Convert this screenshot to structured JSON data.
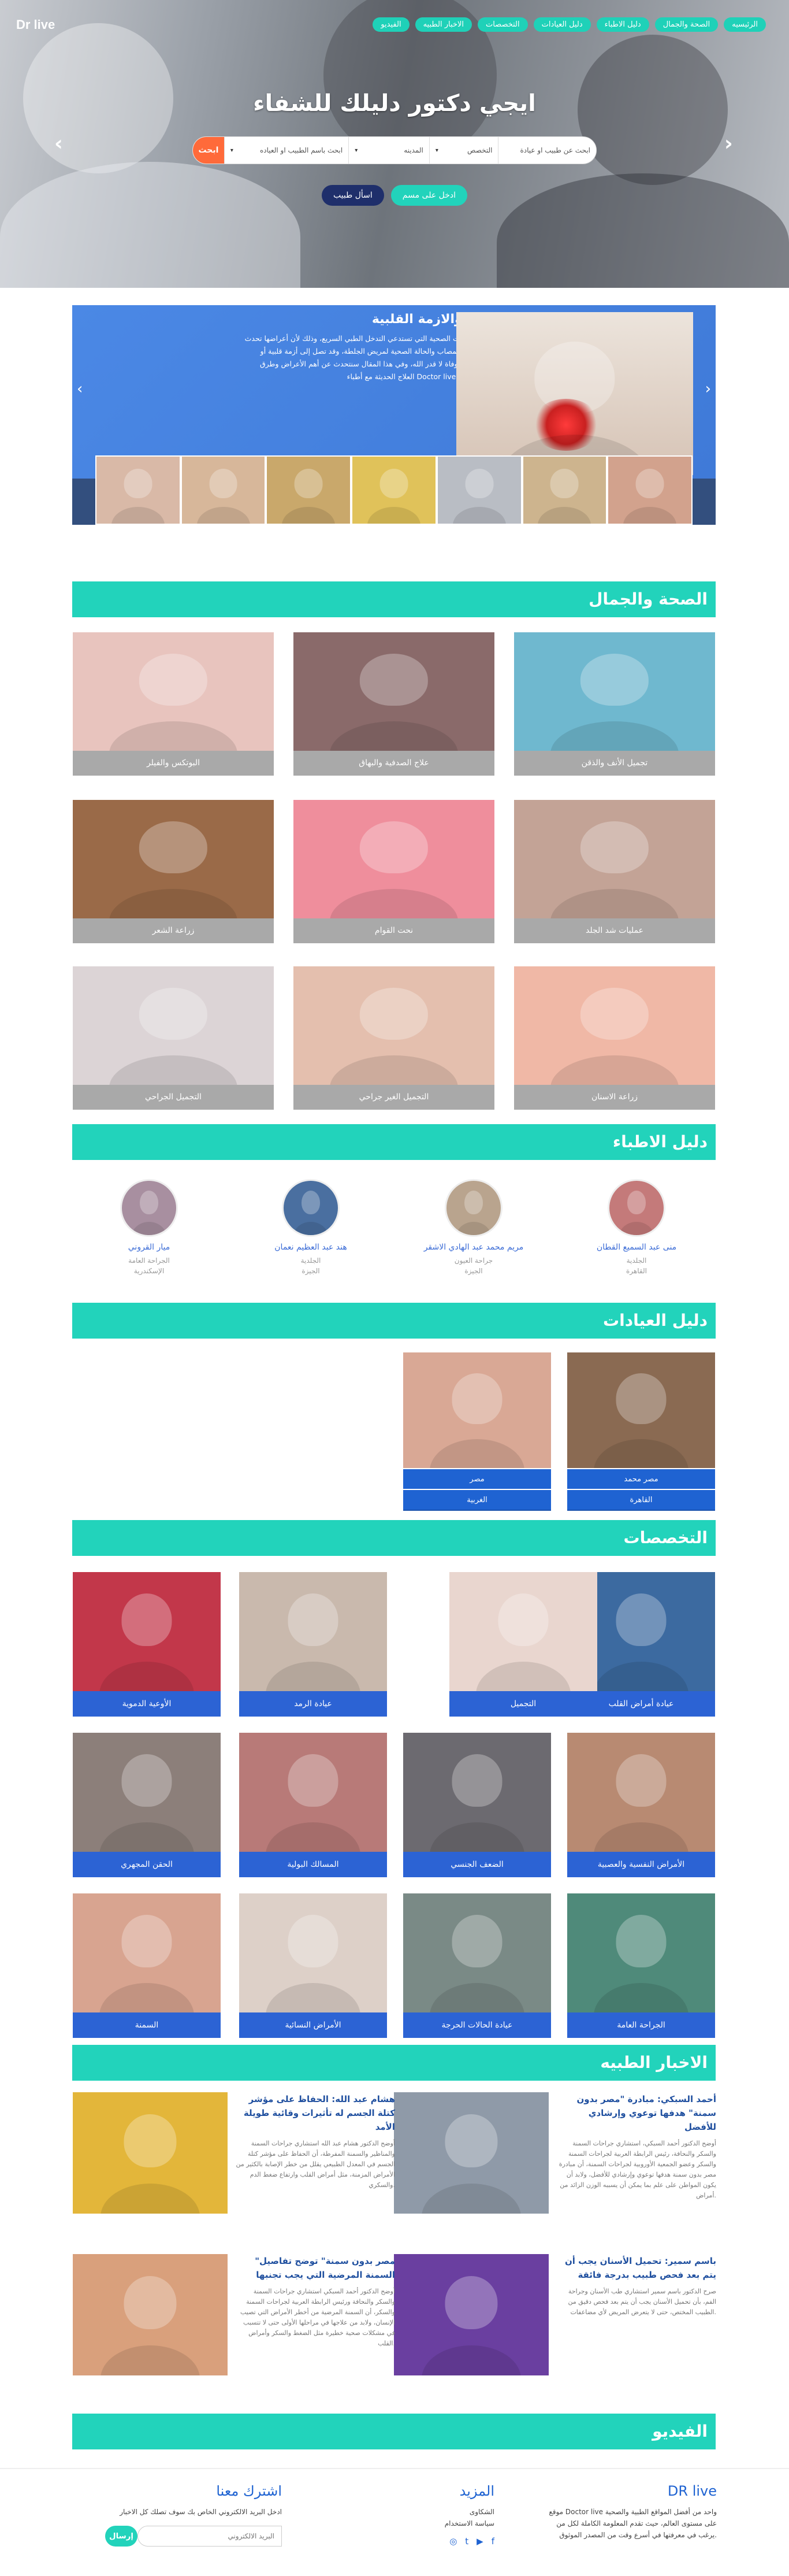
{
  "header": {
    "logo": "Dr live",
    "nav": [
      "الرئيسيه",
      "الصحة والجمال",
      "دليل الاطباء",
      "دليل العيادات",
      "التخصصات",
      "الاخبار الطبيه",
      "الفيديو"
    ]
  },
  "hero": {
    "title": "ايجي دكتور دليلك للشفاء",
    "search_placeholder": "ابحث عن طبيب او عيادة",
    "field_specialty": "التخصص",
    "field_city": "المدينه",
    "field_name": "ابحث باسم الطبيب او العياده",
    "search_button": "ابحث",
    "btn_register": "ادخل على مسم",
    "btn_ask": "اسأل طبيب"
  },
  "slider": {
    "title": "علاج الجلطة والازمة القلبية",
    "body": "الجلطات المختلفة من الحالات الصحية التي تستدعي التدخل الطبي السريع، وذلك لأن أعراضها تحدث الكثير من المضاعفات على المصاب والحالة الصحية لمريض الجلطة، وقد تصل إلى أزمة قلبية أو جلطة دماغية قد تنجم عنها الوفاة لا قدر الله، وفي هذا المقال سنتحدث عن أهم الأعراض وطرق العلاج الحديثة مع أطباء Doctor live المتخصصين في هذا المجال."
  },
  "sections": {
    "beauty": "الصحة والجمال",
    "doctors": "دليل الاطباء",
    "clinics": "دليل العيادات",
    "specialties": "التخصصات",
    "news": "الاخبار الطبيه",
    "video": "الفيديو"
  },
  "beauty": [
    "تجميل الأنف والذقن",
    "علاج الصدفية والبهاق",
    "البوتكس والفيلر",
    "عمليات شد الجلد",
    "نحت القوام",
    "زراعة الشعر",
    "زراعة الاسنان",
    "التجميل الغير جراحي",
    "التجميل الجراحي"
  ],
  "doctors": [
    {
      "name": "منى عبد السميع القطان",
      "spec": "الجلدية",
      "city": "القاهرة"
    },
    {
      "name": "مريم محمد عبد الهادي الاشقر",
      "spec": "جراحة العيون",
      "city": "الجيزة"
    },
    {
      "name": "هند عبد العظيم نعمان",
      "spec": "الجلدية",
      "city": "الجيزة"
    },
    {
      "name": "ميار القروني",
      "spec": "الجراحة العامة",
      "city": "الإسكندرية"
    }
  ],
  "clinics": [
    {
      "name": "مصر محمد",
      "area": "القاهرة"
    },
    {
      "name": "مصر",
      "area": "الغربية"
    }
  ],
  "specialties": [
    "عيادة أمراض القلب",
    "التجميل",
    "عيادة الرمد",
    "الأوعية الدموية",
    "الأمراض النفسية والعصبية",
    "الضعف الجنسي",
    "المسالك البولية",
    "الحقن المجهري",
    "الجراحة العامة",
    "عيادة الحالات الحرجة",
    "الأمراض النسائية",
    "السمنة"
  ],
  "news": [
    {
      "title": "أحمد السبكي: مبادرة \"مصر بدون سمنة\" هدفها توعوي وإرشادي للأفضل",
      "body": "أوضح الدكتور أحمد السبكي، استشاري جراحات السمنة والسكر والنحافة، رئيس الرابطة العربية لجراحات السمنة والسكر وعضو الجمعية الأوروبية لجراحات السمنة، أن مبادرة مصر بدون سمنة هدفها توعوي وإرشادي للأفضل، ولابد أن يكون المواطن على علم بما يمكن أن يسببه الوزن الزائد من أمراض."
    },
    {
      "title": "هشام عبد الله: الحفاظ على مؤشر كتلة الجسم له تأثيرات وقائية طويلة الأمد",
      "body": "أوضح الدكتور هشام عبد الله استشاري جراحات السمنة والمناظير والسمنة المفرطة، أن الحفاظ على مؤشر كتلة الجسم في المعدل الطبيعي يقلل من خطر الإصابة بالكثير من الأمراض المزمنة، مثل أمراض القلب وارتفاع ضغط الدم والسكري."
    },
    {
      "title": "باسم سمير: تحميل الأسنان يجب أن يتم بعد فحص طبيب بدرجة فائقة",
      "body": "صرح الدكتور باسم سمير استشاري طب الأسنان وجراحة الفم، بأن تحميل الأسنان يجب أن يتم بعد فحص دقيق من الطبيب المختص، حتى لا يتعرض المريض لأي مضاعفات."
    },
    {
      "title": "\"مصر بدون سمنة\" توضح تفاصيل السمنة المرضية التي يجب تجنبها",
      "body": "أوضح الدكتور أحمد السبكي استشاري جراحات السمنة والسكر والنحافة ورئيس الرابطة العربية لجراحات السمنة والسكر، أن السمنة المرضية من أخطر الأمراض التي تصيب الإنسان، ولابد من علاجها في مراحلها الأولى حتى لا تتسبب في مشكلات صحية خطيرة مثل الضغط والسكر وأمراض القلب."
    }
  ],
  "footer": {
    "about_title": "DR live",
    "about_text": "موقع Doctor live واحد من أفضل المواقع الطبية والصحية على مستوى العالم، حيث تقدم المعلومة الكاملة لكل من يرغب في معرفتها في أسرع وقت من المصدر الموثوق.",
    "more_title": "المزيد",
    "more_links": [
      "الشكاوى",
      "سياسة الاستخدام"
    ],
    "subscribe_title": "اشترك معنا",
    "subscribe_text": "ادخل البريد الالكتروني الخاص بك سوف تصلك كل الاخبار",
    "email_placeholder": "البريد الالكتروني",
    "subscribe_button": "إرسال"
  }
}
